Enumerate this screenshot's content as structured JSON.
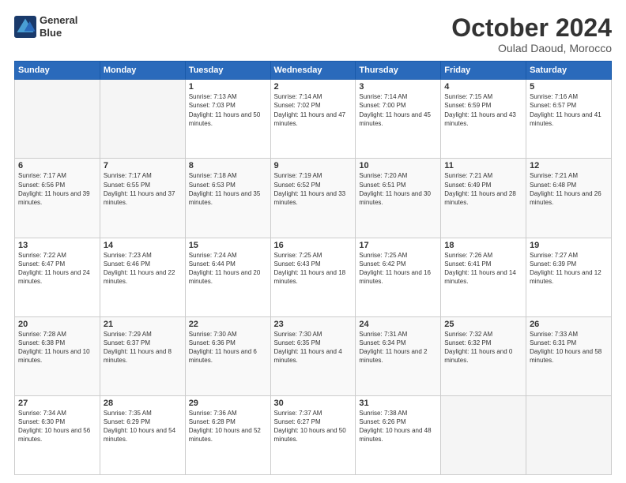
{
  "logo": {
    "line1": "General",
    "line2": "Blue"
  },
  "title": "October 2024",
  "location": "Oulad Daoud, Morocco",
  "days_of_week": [
    "Sunday",
    "Monday",
    "Tuesday",
    "Wednesday",
    "Thursday",
    "Friday",
    "Saturday"
  ],
  "weeks": [
    [
      {
        "day": "",
        "info": ""
      },
      {
        "day": "",
        "info": ""
      },
      {
        "day": "1",
        "info": "Sunrise: 7:13 AM\nSunset: 7:03 PM\nDaylight: 11 hours and 50 minutes."
      },
      {
        "day": "2",
        "info": "Sunrise: 7:14 AM\nSunset: 7:02 PM\nDaylight: 11 hours and 47 minutes."
      },
      {
        "day": "3",
        "info": "Sunrise: 7:14 AM\nSunset: 7:00 PM\nDaylight: 11 hours and 45 minutes."
      },
      {
        "day": "4",
        "info": "Sunrise: 7:15 AM\nSunset: 6:59 PM\nDaylight: 11 hours and 43 minutes."
      },
      {
        "day": "5",
        "info": "Sunrise: 7:16 AM\nSunset: 6:57 PM\nDaylight: 11 hours and 41 minutes."
      }
    ],
    [
      {
        "day": "6",
        "info": "Sunrise: 7:17 AM\nSunset: 6:56 PM\nDaylight: 11 hours and 39 minutes."
      },
      {
        "day": "7",
        "info": "Sunrise: 7:17 AM\nSunset: 6:55 PM\nDaylight: 11 hours and 37 minutes."
      },
      {
        "day": "8",
        "info": "Sunrise: 7:18 AM\nSunset: 6:53 PM\nDaylight: 11 hours and 35 minutes."
      },
      {
        "day": "9",
        "info": "Sunrise: 7:19 AM\nSunset: 6:52 PM\nDaylight: 11 hours and 33 minutes."
      },
      {
        "day": "10",
        "info": "Sunrise: 7:20 AM\nSunset: 6:51 PM\nDaylight: 11 hours and 30 minutes."
      },
      {
        "day": "11",
        "info": "Sunrise: 7:21 AM\nSunset: 6:49 PM\nDaylight: 11 hours and 28 minutes."
      },
      {
        "day": "12",
        "info": "Sunrise: 7:21 AM\nSunset: 6:48 PM\nDaylight: 11 hours and 26 minutes."
      }
    ],
    [
      {
        "day": "13",
        "info": "Sunrise: 7:22 AM\nSunset: 6:47 PM\nDaylight: 11 hours and 24 minutes."
      },
      {
        "day": "14",
        "info": "Sunrise: 7:23 AM\nSunset: 6:46 PM\nDaylight: 11 hours and 22 minutes."
      },
      {
        "day": "15",
        "info": "Sunrise: 7:24 AM\nSunset: 6:44 PM\nDaylight: 11 hours and 20 minutes."
      },
      {
        "day": "16",
        "info": "Sunrise: 7:25 AM\nSunset: 6:43 PM\nDaylight: 11 hours and 18 minutes."
      },
      {
        "day": "17",
        "info": "Sunrise: 7:25 AM\nSunset: 6:42 PM\nDaylight: 11 hours and 16 minutes."
      },
      {
        "day": "18",
        "info": "Sunrise: 7:26 AM\nSunset: 6:41 PM\nDaylight: 11 hours and 14 minutes."
      },
      {
        "day": "19",
        "info": "Sunrise: 7:27 AM\nSunset: 6:39 PM\nDaylight: 11 hours and 12 minutes."
      }
    ],
    [
      {
        "day": "20",
        "info": "Sunrise: 7:28 AM\nSunset: 6:38 PM\nDaylight: 11 hours and 10 minutes."
      },
      {
        "day": "21",
        "info": "Sunrise: 7:29 AM\nSunset: 6:37 PM\nDaylight: 11 hours and 8 minutes."
      },
      {
        "day": "22",
        "info": "Sunrise: 7:30 AM\nSunset: 6:36 PM\nDaylight: 11 hours and 6 minutes."
      },
      {
        "day": "23",
        "info": "Sunrise: 7:30 AM\nSunset: 6:35 PM\nDaylight: 11 hours and 4 minutes."
      },
      {
        "day": "24",
        "info": "Sunrise: 7:31 AM\nSunset: 6:34 PM\nDaylight: 11 hours and 2 minutes."
      },
      {
        "day": "25",
        "info": "Sunrise: 7:32 AM\nSunset: 6:32 PM\nDaylight: 11 hours and 0 minutes."
      },
      {
        "day": "26",
        "info": "Sunrise: 7:33 AM\nSunset: 6:31 PM\nDaylight: 10 hours and 58 minutes."
      }
    ],
    [
      {
        "day": "27",
        "info": "Sunrise: 7:34 AM\nSunset: 6:30 PM\nDaylight: 10 hours and 56 minutes."
      },
      {
        "day": "28",
        "info": "Sunrise: 7:35 AM\nSunset: 6:29 PM\nDaylight: 10 hours and 54 minutes."
      },
      {
        "day": "29",
        "info": "Sunrise: 7:36 AM\nSunset: 6:28 PM\nDaylight: 10 hours and 52 minutes."
      },
      {
        "day": "30",
        "info": "Sunrise: 7:37 AM\nSunset: 6:27 PM\nDaylight: 10 hours and 50 minutes."
      },
      {
        "day": "31",
        "info": "Sunrise: 7:38 AM\nSunset: 6:26 PM\nDaylight: 10 hours and 48 minutes."
      },
      {
        "day": "",
        "info": ""
      },
      {
        "day": "",
        "info": ""
      }
    ]
  ]
}
